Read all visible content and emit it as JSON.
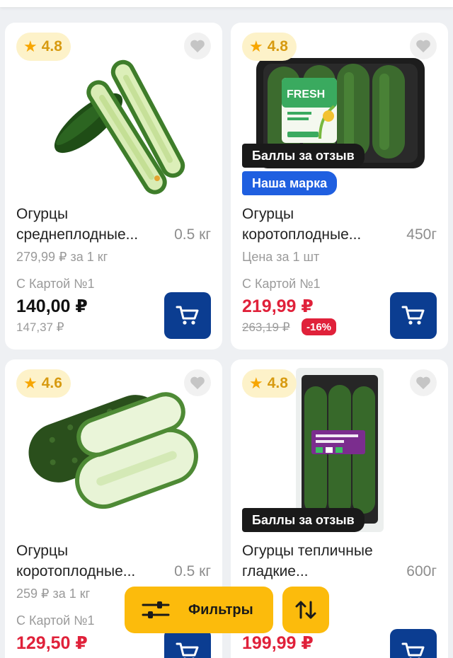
{
  "products": [
    {
      "rating": "4.8",
      "name_line1": "Огурцы",
      "name_line2": "среднеплодные...",
      "weight": "0.5 кг",
      "unit_price": "279,99 ₽ за 1 кг",
      "card_label": "С Картой №1",
      "price": "140,00 ₽",
      "old_price": "147,37 ₽"
    },
    {
      "rating": "4.8",
      "review_badge": "Баллы за отзыв",
      "brand_badge": "Наша марка",
      "pack_brand": "FRESH",
      "name_line1": "Огурцы",
      "name_line2": "коротоплодные...",
      "weight": "450г",
      "unit_price": "Цена за 1 шт",
      "card_label": "С Картой №1",
      "price": "219,99 ₽",
      "old_price": "263,19 ₽",
      "discount": "-16%"
    },
    {
      "rating": "4.6",
      "name_line1": "Огурцы",
      "name_line2": "коротоплодные...",
      "weight": "0.5 кг",
      "unit_price": "259 ₽ за 1 кг",
      "card_label": "С Картой №1",
      "price": "129,50 ₽"
    },
    {
      "rating": "4.8",
      "review_badge": "Баллы за отзыв",
      "name_line1": "Огурцы тепличные",
      "name_line2": "гладкие...",
      "weight": "600г",
      "price": "199,99 ₽"
    }
  ],
  "toolbar": {
    "filters_label": "Фильтры"
  },
  "colors": {
    "accent_yellow": "#fcbb0c",
    "cart_blue": "#0b3d91",
    "brand_blue": "#1f5fe0",
    "price_red": "#e0213a"
  },
  "icons": {
    "rating": "star-icon",
    "favorite": "heart-icon",
    "cart": "cart-icon",
    "filters": "sliders-icon",
    "sort": "sort-arrows-icon"
  }
}
